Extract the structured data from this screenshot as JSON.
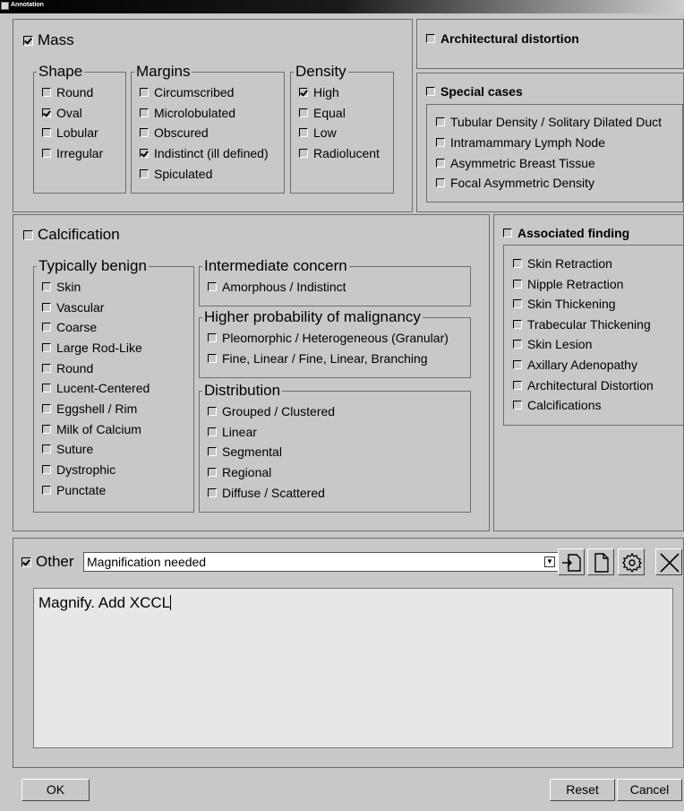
{
  "window": {
    "title": "Annotation"
  },
  "mass": {
    "label": "Mass",
    "checked": true,
    "shape": {
      "legend": "Shape",
      "items": [
        {
          "label": "Round",
          "checked": false
        },
        {
          "label": "Oval",
          "checked": true
        },
        {
          "label": "Lobular",
          "checked": false
        },
        {
          "label": "Irregular",
          "checked": false
        }
      ]
    },
    "margins": {
      "legend": "Margins",
      "items": [
        {
          "label": "Circumscribed",
          "checked": false
        },
        {
          "label": "Microlobulated",
          "checked": false
        },
        {
          "label": "Obscured",
          "checked": false
        },
        {
          "label": "Indistinct (ill defined)",
          "checked": true
        },
        {
          "label": "Spiculated",
          "checked": false
        }
      ]
    },
    "density": {
      "legend": "Density",
      "items": [
        {
          "label": "High",
          "checked": true
        },
        {
          "label": "Equal",
          "checked": false
        },
        {
          "label": "Low",
          "checked": false
        },
        {
          "label": "Radiolucent",
          "checked": false
        }
      ]
    }
  },
  "architectural_distortion": {
    "label": "Architectural distortion",
    "checked": false
  },
  "special_cases": {
    "label": "Special cases",
    "checked": false,
    "items": [
      {
        "label": "Tubular Density / Solitary Dilated Duct",
        "checked": false
      },
      {
        "label": "Intramammary Lymph Node",
        "checked": false
      },
      {
        "label": "Asymmetric Breast Tissue",
        "checked": false
      },
      {
        "label": "Focal Asymmetric Density",
        "checked": false
      }
    ]
  },
  "calcification": {
    "label": "Calcification",
    "checked": false,
    "typically_benign": {
      "legend": "Typically benign",
      "items": [
        {
          "label": "Skin",
          "checked": false
        },
        {
          "label": "Vascular",
          "checked": false
        },
        {
          "label": "Coarse",
          "checked": false
        },
        {
          "label": "Large Rod-Like",
          "checked": false
        },
        {
          "label": "Round",
          "checked": false
        },
        {
          "label": "Lucent-Centered",
          "checked": false
        },
        {
          "label": "Eggshell / Rim",
          "checked": false
        },
        {
          "label": "Milk of Calcium",
          "checked": false
        },
        {
          "label": "Suture",
          "checked": false
        },
        {
          "label": "Dystrophic",
          "checked": false
        },
        {
          "label": "Punctate",
          "checked": false
        }
      ]
    },
    "intermediate": {
      "legend": "Intermediate concern",
      "items": [
        {
          "label": "Amorphous / Indistinct",
          "checked": false
        }
      ]
    },
    "higher_probability": {
      "legend": "Higher probability of malignancy",
      "items": [
        {
          "label": "Pleomorphic / Heterogeneous (Granular)",
          "checked": false
        },
        {
          "label": "Fine, Linear / Fine, Linear, Branching",
          "checked": false
        }
      ]
    },
    "distribution": {
      "legend": "Distribution",
      "items": [
        {
          "label": "Grouped / Clustered",
          "checked": false
        },
        {
          "label": "Linear",
          "checked": false
        },
        {
          "label": "Segmental",
          "checked": false
        },
        {
          "label": "Regional",
          "checked": false
        },
        {
          "label": "Diffuse / Scattered",
          "checked": false
        }
      ]
    }
  },
  "associated_finding": {
    "label": "Associated finding",
    "checked": false,
    "items": [
      {
        "label": "Skin Retraction",
        "checked": false
      },
      {
        "label": "Nipple Retraction",
        "checked": false
      },
      {
        "label": "Skin Thickening",
        "checked": false
      },
      {
        "label": "Trabecular Thickening",
        "checked": false
      },
      {
        "label": "Skin Lesion",
        "checked": false
      },
      {
        "label": "Axillary Adenopathy",
        "checked": false
      },
      {
        "label": "Architectural Distortion",
        "checked": false
      },
      {
        "label": "Calcifications",
        "checked": false
      }
    ]
  },
  "other": {
    "label": "Other",
    "checked": true,
    "selected": "Magnification needed",
    "notes": "Magnify. Add XCCL"
  },
  "icons": {
    "new_from": "new-from-template-icon",
    "new": "new-document-icon",
    "settings": "gear-icon",
    "delete": "close-icon"
  },
  "buttons": {
    "ok": "OK",
    "reset": "Reset",
    "cancel": "Cancel"
  }
}
